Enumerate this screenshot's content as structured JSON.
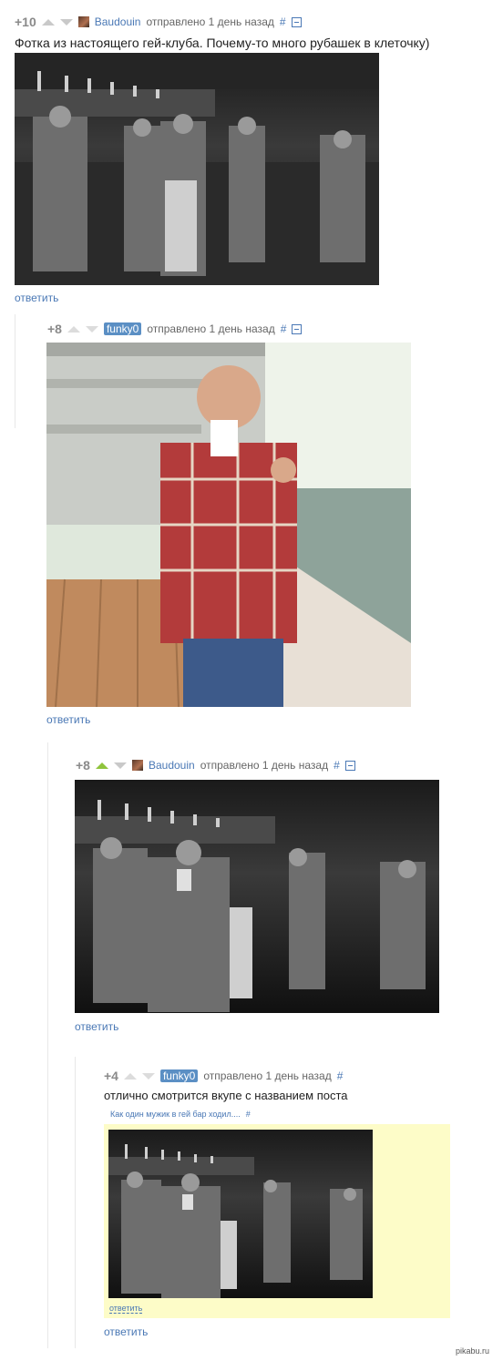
{
  "comments": [
    {
      "rating": "+10",
      "author": "Baudouin",
      "posted": "отправлено 1 день назад",
      "hash": "#",
      "text": "Фотка из настоящего гей-клуба. Почему-то много рубашек в клеточку)",
      "reply": "ответить"
    },
    {
      "rating": "+8",
      "author": "funky0",
      "posted": "отправлено 1 день назад",
      "hash": "#",
      "reply": "ответить"
    },
    {
      "rating": "+8",
      "author": "Baudouin",
      "posted": "отправлено 1 день назад",
      "hash": "#",
      "reply": "ответить"
    },
    {
      "rating": "+4",
      "author": "funky0",
      "posted": "отправлено 1 день назад",
      "hash": "#",
      "text": "отлично смотрится вкупе с названием поста",
      "embed_title": "Как один мужик в гей бар ходил....",
      "embed_hash": "#",
      "embed_reply": "ответить",
      "reply": "ответить"
    }
  ],
  "watermark": "pikabu.ru",
  "colors": {
    "link": "#4a78b5",
    "badge": "#5b8fc4",
    "upvote_active": "#8fc43c",
    "embed_bg": "#fdfcc8"
  }
}
